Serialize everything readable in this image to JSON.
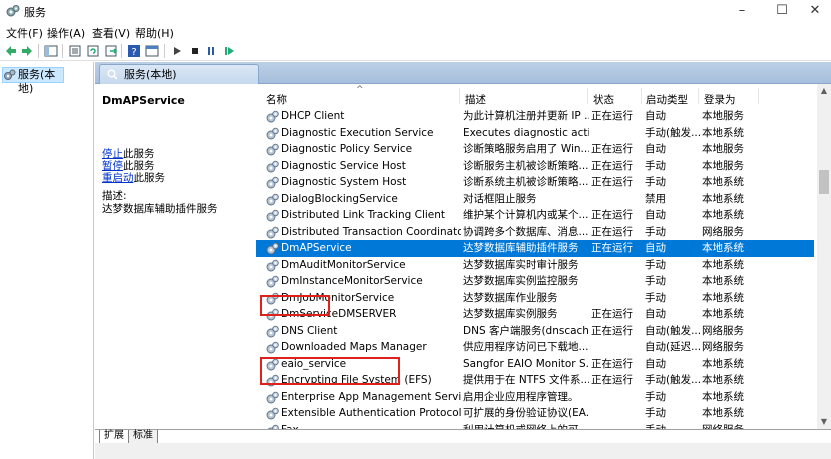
{
  "window": {
    "title": "服务",
    "minimize": "–",
    "maximize": "☐",
    "close": "✕"
  },
  "menu": [
    "文件(F)",
    "操作(A)",
    "查看(V)",
    "帮助(H)"
  ],
  "toolbar_icons": [
    "back-icon",
    "forward-icon",
    "console-tree-icon",
    "properties-icon",
    "refresh-icon",
    "export-icon",
    "help-icon",
    "view-icon",
    "start-icon",
    "stop-icon",
    "pause-icon",
    "restart-icon"
  ],
  "tree": {
    "item": "服务(本地)"
  },
  "panel": {
    "tab": "服务(本地)"
  },
  "detail": {
    "service_name": "DmAPService",
    "actions": [
      {
        "link": "停止",
        "rest": "此服务"
      },
      {
        "link": "暂停",
        "rest": "此服务"
      },
      {
        "link": "重启动",
        "rest": "此服务"
      }
    ],
    "desc_label": "描述:",
    "desc_text": "达梦数据库辅助插件服务"
  },
  "columns": {
    "name": "名称",
    "desc": "描述",
    "status": "状态",
    "start": "启动类型",
    "logon": "登录为"
  },
  "rows": [
    {
      "name": "DHCP Client",
      "desc": "为此计算机注册并更新 IP ...",
      "status": "正在运行",
      "start": "自动",
      "logon": "本地服务"
    },
    {
      "name": "Diagnostic Execution Service",
      "desc": "Executes diagnostic acti...",
      "status": "",
      "start": "手动(触发...",
      "logon": "本地系统"
    },
    {
      "name": "Diagnostic Policy Service",
      "desc": "诊断策略服务启用了 Win...",
      "status": "正在运行",
      "start": "自动",
      "logon": "本地服务"
    },
    {
      "name": "Diagnostic Service Host",
      "desc": "诊断服务主机被诊断策略...",
      "status": "正在运行",
      "start": "手动",
      "logon": "本地服务"
    },
    {
      "name": "Diagnostic System Host",
      "desc": "诊断系统主机被诊断策略...",
      "status": "正在运行",
      "start": "手动",
      "logon": "本地系统"
    },
    {
      "name": "DialogBlockingService",
      "desc": "对话框阻止服务",
      "status": "",
      "start": "禁用",
      "logon": "本地系统"
    },
    {
      "name": "Distributed Link Tracking Client",
      "desc": "维护某个计算机内或某个...",
      "status": "正在运行",
      "start": "自动",
      "logon": "本地系统"
    },
    {
      "name": "Distributed Transaction Coordinator",
      "desc": "协调跨多个数据库、消息...",
      "status": "正在运行",
      "start": "手动",
      "logon": "网络服务"
    },
    {
      "name": "DmAPService",
      "desc": "达梦数据库辅助插件服务",
      "status": "正在运行",
      "start": "自动",
      "logon": "本地系统",
      "selected": true
    },
    {
      "name": "DmAuditMonitorService",
      "desc": "达梦数据库实时审计服务",
      "status": "",
      "start": "手动",
      "logon": "本地系统"
    },
    {
      "name": "DmInstanceMonitorService",
      "desc": "达梦数据库实例监控服务",
      "status": "",
      "start": "手动",
      "logon": "本地系统"
    },
    {
      "name": "DmJobMonitorService",
      "desc": "达梦数据库作业服务",
      "status": "",
      "start": "手动",
      "logon": "本地系统"
    },
    {
      "name": "DmServiceDMSERVER",
      "desc": "达梦数据库实例服务",
      "status": "正在运行",
      "start": "自动",
      "logon": "本地系统"
    },
    {
      "name": "DNS Client",
      "desc": "DNS 客户端服务(dnscach...",
      "status": "正在运行",
      "start": "自动(触发...",
      "logon": "网络服务"
    },
    {
      "name": "Downloaded Maps Manager",
      "desc": "供应用程序访问已下载地...",
      "status": "",
      "start": "自动(延迟...",
      "logon": "网络服务"
    },
    {
      "name": "eaio_service",
      "desc": "Sangfor EAIO Monitor S...",
      "status": "正在运行",
      "start": "自动",
      "logon": "本地系统"
    },
    {
      "name": "Encrypting File System (EFS)",
      "desc": "提供用于在 NTFS 文件系...",
      "status": "正在运行",
      "start": "手动(触发...",
      "logon": "本地系统"
    },
    {
      "name": "Enterprise App Management Service",
      "desc": "启用企业应用程序管理。",
      "status": "",
      "start": "手动",
      "logon": "本地系统"
    },
    {
      "name": "Extensible Authentication Protocol",
      "desc": "可扩展的身份验证协议(EA...",
      "status": "",
      "start": "手动",
      "logon": "本地系统"
    },
    {
      "name": "Fax",
      "desc": "利用计算机或网络上的可...",
      "status": "",
      "start": "手动",
      "logon": "网络服务"
    }
  ],
  "bottom_tabs": [
    "扩展",
    "标准"
  ],
  "colors": {
    "selection": "#0078d7",
    "highlight_box": "#e0201a",
    "link": "#0033cc"
  }
}
